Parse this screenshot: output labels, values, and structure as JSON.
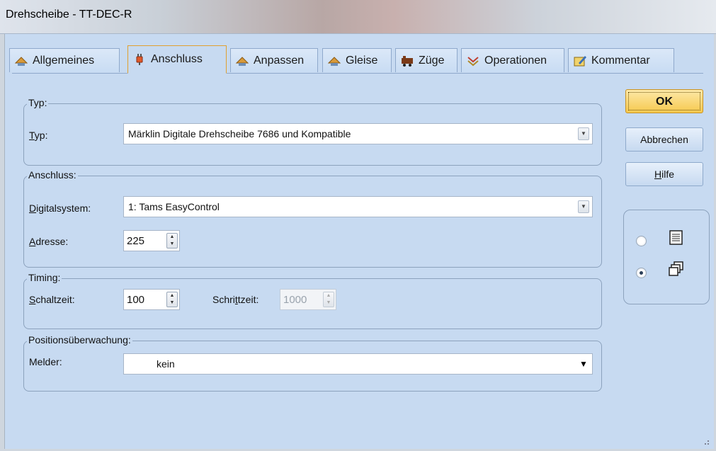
{
  "window": {
    "title": "Drehscheibe - TT-DEC-R"
  },
  "tabs": [
    {
      "label": "Allgemeines",
      "icon": "hat-icon"
    },
    {
      "label": "Anschluss",
      "icon": "plug-icon"
    },
    {
      "label": "Anpassen",
      "icon": "hat-icon"
    },
    {
      "label": "Gleise",
      "icon": "hat-icon"
    },
    {
      "label": "Züge",
      "icon": "train-icon"
    },
    {
      "label": "Operationen",
      "icon": "operations-icon"
    },
    {
      "label": "Kommentar",
      "icon": "comment-icon"
    }
  ],
  "typ": {
    "group_title": "Typ:",
    "label_rest": "yp:",
    "label_key": "T",
    "value": "Märklin Digitale Drehscheibe 7686 und Kompatible"
  },
  "anschluss": {
    "group_title": "Anschluss:",
    "digital_key": "D",
    "digital_rest": "igitalsystem:",
    "digital_value": "1: Tams EasyControl",
    "adresse_key": "A",
    "adresse_rest": "dresse:",
    "adresse_value": "225"
  },
  "timing": {
    "group_title": "Timing:",
    "schalt_key": "S",
    "schalt_rest": "chaltzeit:",
    "schalt_value": "100",
    "schritt_pre": "Schri",
    "schritt_key": "t",
    "schritt_rest": "tzeit:",
    "schritt_value": "1000"
  },
  "position": {
    "group_title": "Positionsüberwachung:",
    "melder_label": "Melder:",
    "melder_value": "kein"
  },
  "buttons": {
    "ok": "OK",
    "cancel": "Abbrechen",
    "help_key": "H",
    "help_rest": "ilfe"
  },
  "view_options": [
    {
      "icon": "list-view-icon",
      "checked": false
    },
    {
      "icon": "cascade-windows-icon",
      "checked": true
    }
  ],
  "colors": {
    "client_bg": "#c7daf1",
    "active_tab_border": "#e0a030",
    "default_button": "#f6c94e"
  }
}
